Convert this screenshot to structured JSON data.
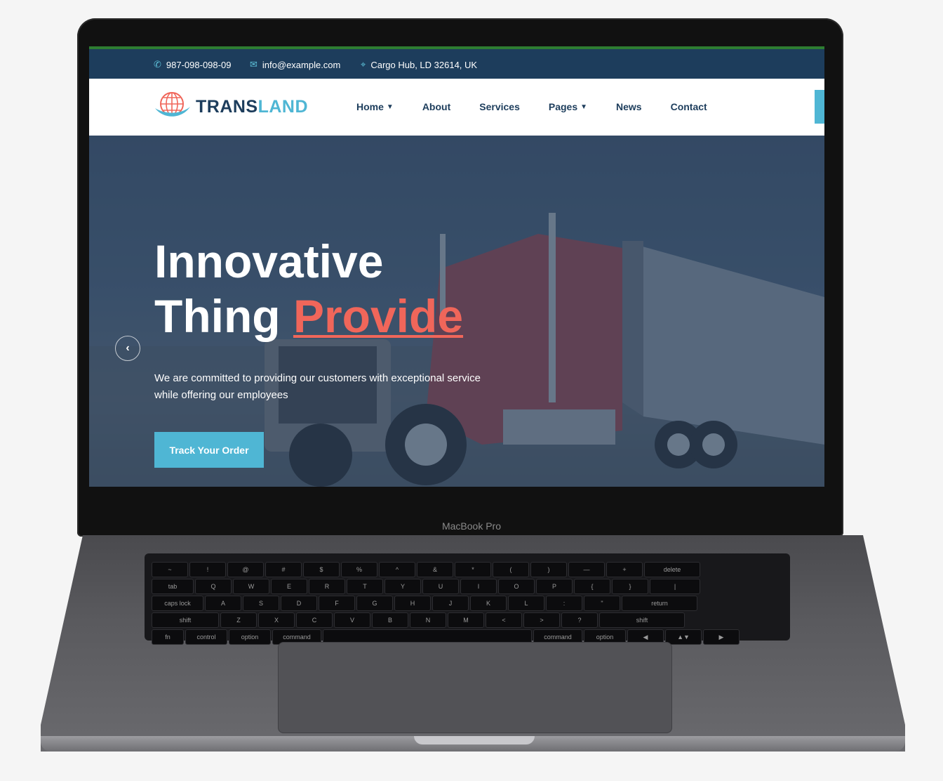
{
  "topbar": {
    "phone": "987-098-098-09",
    "email": "info@example.com",
    "address": "Cargo Hub, LD 32614, UK"
  },
  "logo": {
    "part1": "TRANS",
    "part2": "LAND"
  },
  "menu": [
    {
      "label": "Home",
      "dropdown": true
    },
    {
      "label": "About",
      "dropdown": false
    },
    {
      "label": "Services",
      "dropdown": false
    },
    {
      "label": "Pages",
      "dropdown": true
    },
    {
      "label": "News",
      "dropdown": false
    },
    {
      "label": "Contact",
      "dropdown": false
    }
  ],
  "hero": {
    "line1": "Innovative",
    "line2_a": "Thing",
    "line2_b": "Provide",
    "subtext": "We are committed to providing our customers with exceptional service while offering our employees",
    "cta": "Track Your Order",
    "prev_icon": "chevron-left-icon"
  },
  "device_label": "MacBook Pro",
  "keyboard_rows": [
    [
      "~",
      "!",
      "@",
      "#",
      "$",
      "%",
      "^",
      "&",
      "*",
      "(",
      ")",
      "—",
      "+",
      "delete"
    ],
    [
      "tab",
      "Q",
      "W",
      "E",
      "R",
      "T",
      "Y",
      "U",
      "I",
      "O",
      "P",
      "{",
      "}",
      "|"
    ],
    [
      "caps lock",
      "A",
      "S",
      "D",
      "F",
      "G",
      "H",
      "J",
      "K",
      "L",
      ":",
      "\"",
      "return"
    ],
    [
      "shift",
      "Z",
      "X",
      "C",
      "V",
      "B",
      "N",
      "M",
      "<",
      ">",
      "?",
      "shift"
    ],
    [
      "fn",
      "control",
      "option",
      "command",
      "",
      "command",
      "option",
      "◀",
      "▲▼",
      "▶"
    ]
  ],
  "colors": {
    "accent": "#4fb6d4",
    "navy": "#1d3d5c",
    "highlight": "#f0665a"
  }
}
